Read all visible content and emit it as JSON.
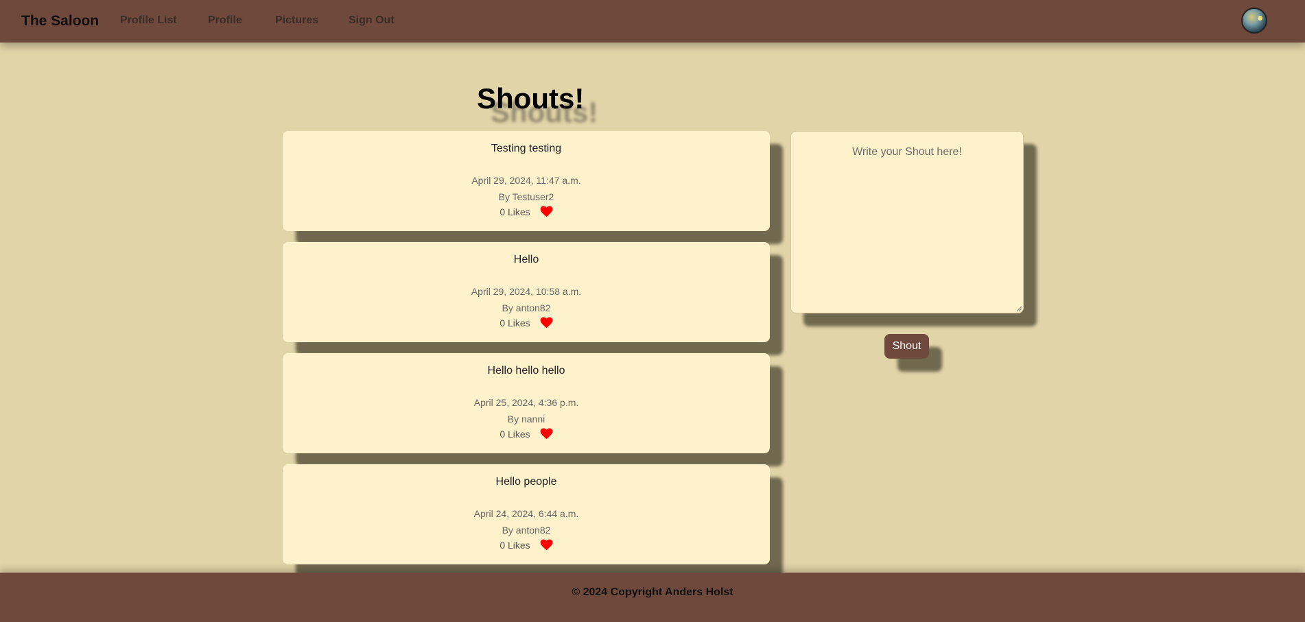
{
  "navbar": {
    "brand": "The Saloon",
    "links": [
      "Profile List",
      "Profile",
      "Pictures",
      "Sign Out"
    ]
  },
  "page": {
    "title": "Shouts!"
  },
  "shouts": [
    {
      "content": "Testing testing",
      "date": "April 29, 2024, 11:47 a.m.",
      "author": "By Testuser2",
      "likes": "0 Likes"
    },
    {
      "content": "Hello",
      "date": "April 29, 2024, 10:58 a.m.",
      "author": "By anton82",
      "likes": "0 Likes"
    },
    {
      "content": "Hello hello hello",
      "date": "April 25, 2024, 4:36 p.m.",
      "author": "By nanni",
      "likes": "0 Likes"
    },
    {
      "content": "Hello people",
      "date": "April 24, 2024, 6:44 a.m.",
      "author": "By anton82",
      "likes": "0 Likes"
    }
  ],
  "compose": {
    "placeholder": "Write your Shout here!",
    "value": "",
    "submit_label": "Shout"
  },
  "footer": {
    "text": "© 2024 Copyright Anders Holst"
  },
  "colors": {
    "background": "#e1d4a8",
    "bar": "#6f493c",
    "card": "#fdf2cc",
    "heart": "#ff0000"
  },
  "icons": {
    "like": "heart-icon",
    "avatar": "avatar"
  }
}
